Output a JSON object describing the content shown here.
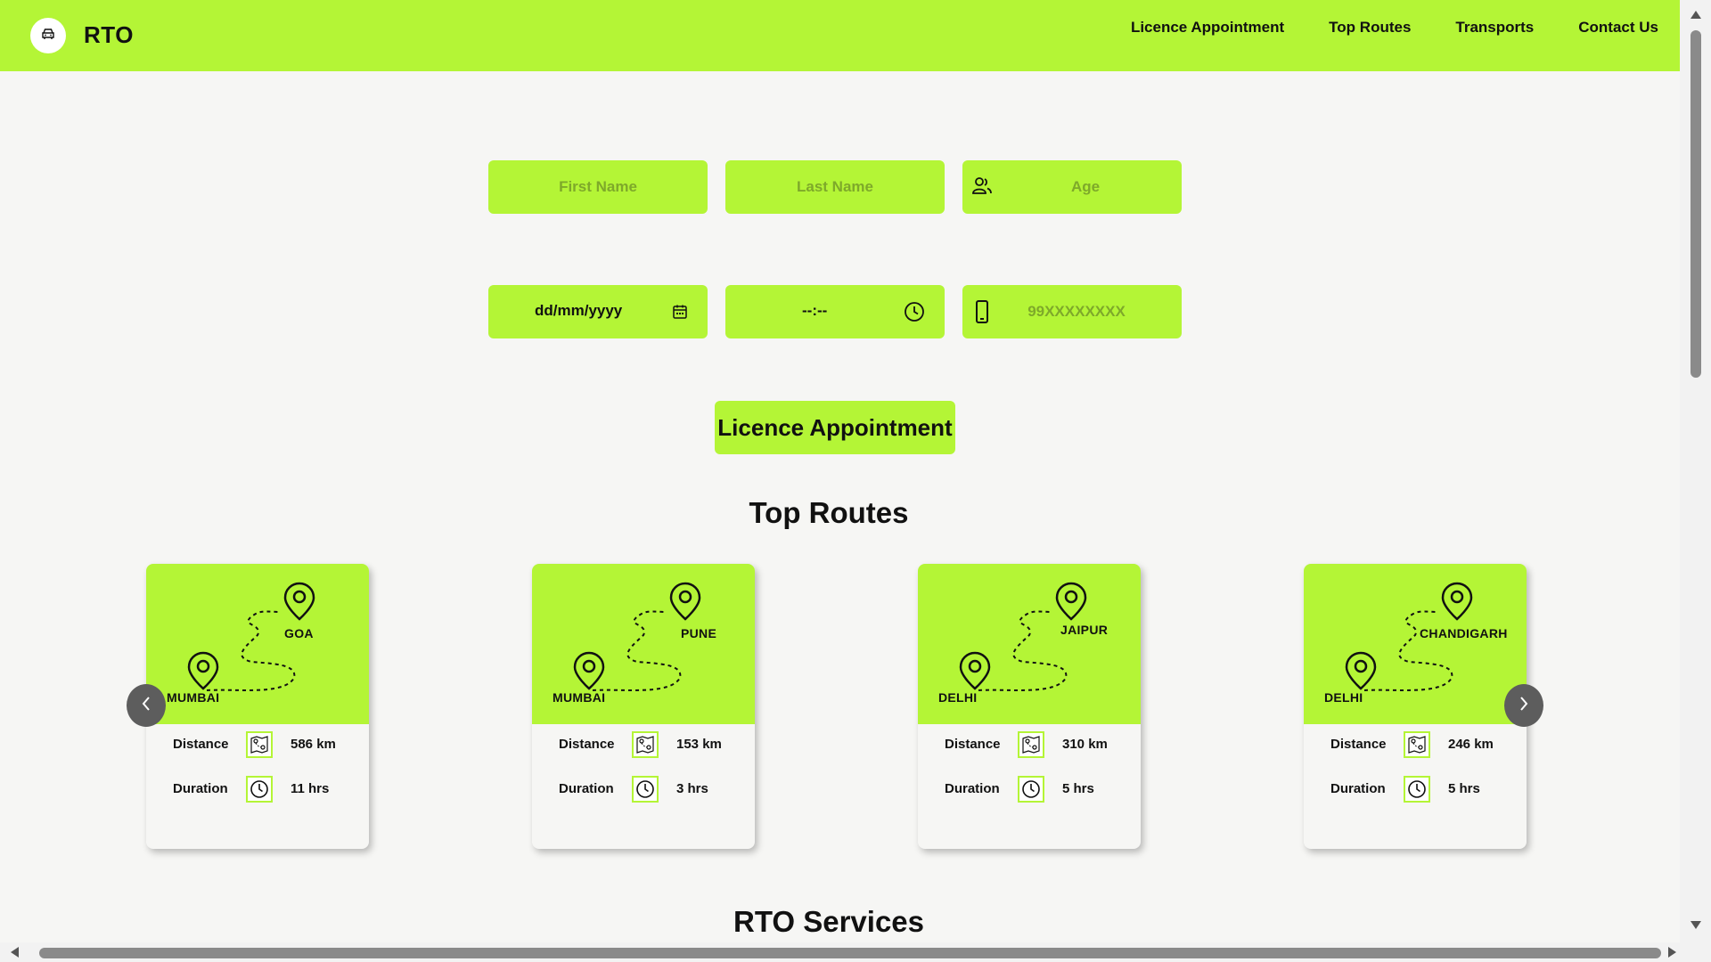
{
  "header": {
    "logo_text": "RTO",
    "logo_icon": "car-icon",
    "nav": [
      "Licence Appointment",
      "Top Routes",
      "Transports",
      "Contact Us"
    ]
  },
  "form": {
    "first_name_placeholder": "First Name",
    "last_name_placeholder": "Last Name",
    "age_placeholder": "Age",
    "date_value": "dd/mm/yyyy",
    "time_value": "--:--",
    "phone_placeholder": "99XXXXXXXX",
    "submit_label": "Licence Appointment"
  },
  "top_routes": {
    "title": "Top Routes",
    "distance_label": "Distance",
    "duration_label": "Duration",
    "routes": [
      {
        "from": "MUMBAI",
        "to": "GOA",
        "distance": "586 km",
        "duration": "11 hrs"
      },
      {
        "from": "MUMBAI",
        "to": "PUNE",
        "distance": "153 km",
        "duration": "3 hrs"
      },
      {
        "from": "DELHI",
        "to": "JAIPUR",
        "distance": "310 km",
        "duration": "5 hrs"
      },
      {
        "from": "DELHI",
        "to": "CHANDIGARH",
        "distance": "246 km",
        "duration": "5 hrs"
      }
    ]
  },
  "services": {
    "title": "RTO Services"
  },
  "colors": {
    "accent": "#b4f536",
    "background": "#f6f6f4",
    "text": "#111111"
  }
}
